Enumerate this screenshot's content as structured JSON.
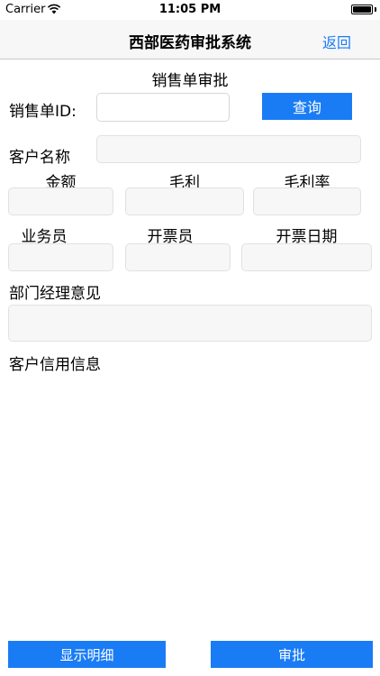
{
  "status_bar": {
    "carrier": "Carrier",
    "time": "11:05 PM"
  },
  "nav": {
    "title": "西部医药审批系统",
    "back_label": "返回"
  },
  "page": {
    "section_title": "销售单审批"
  },
  "form": {
    "order_id_label": "销售单ID:",
    "order_id_value": "",
    "query_label": "查询",
    "customer_name_label": "客户名称",
    "amount_label": "金额",
    "gross_profit_label": "毛利",
    "gross_margin_label": "毛利率",
    "salesperson_label": "业务员",
    "invoicer_label": "开票员",
    "invoice_date_label": "开票日期",
    "manager_opinion_label": "部门经理意见",
    "credit_info_label": "客户信用信息"
  },
  "actions": {
    "show_details_label": "显示明细",
    "approve_label": "审批"
  },
  "colors": {
    "accent": "#1a7cf5",
    "field_bg": "#f7f7f7"
  }
}
